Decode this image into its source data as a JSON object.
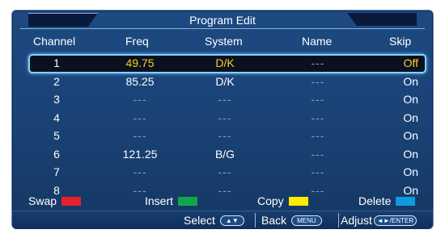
{
  "title": "Program Edit",
  "columns": {
    "channel": "Channel",
    "freq": "Freq",
    "system": "System",
    "name": "Name",
    "skip": "Skip"
  },
  "rows": [
    {
      "channel": "1",
      "freq": "49.75",
      "system": "D/K",
      "name": "---",
      "skip": "Off"
    },
    {
      "channel": "2",
      "freq": "85.25",
      "system": "D/K",
      "name": "---",
      "skip": "On"
    },
    {
      "channel": "3",
      "freq": "---",
      "system": "---",
      "name": "---",
      "skip": "On"
    },
    {
      "channel": "4",
      "freq": "---",
      "system": "---",
      "name": "---",
      "skip": "On"
    },
    {
      "channel": "5",
      "freq": "---",
      "system": "---",
      "name": "---",
      "skip": "On"
    },
    {
      "channel": "6",
      "freq": "121.25",
      "system": "B/G",
      "name": "---",
      "skip": "On"
    },
    {
      "channel": "7",
      "freq": "---",
      "system": "---",
      "name": "---",
      "skip": "On"
    },
    {
      "channel": "8",
      "freq": "---",
      "system": "---",
      "name": "---",
      "skip": "On"
    }
  ],
  "legend": {
    "swap": "Swap",
    "insert": "Insert",
    "copy": "Copy",
    "delete": "Delete"
  },
  "legend_colors": {
    "swap": "#e8202e",
    "insert": "#12a64b",
    "copy": "#ffea00",
    "delete": "#1098e0"
  },
  "bottom": {
    "select": "Select",
    "select_key": "▲▼",
    "back": "Back",
    "back_key": "MENU",
    "adjust": "Adjust",
    "adjust_key": "◄►/ENTER"
  }
}
